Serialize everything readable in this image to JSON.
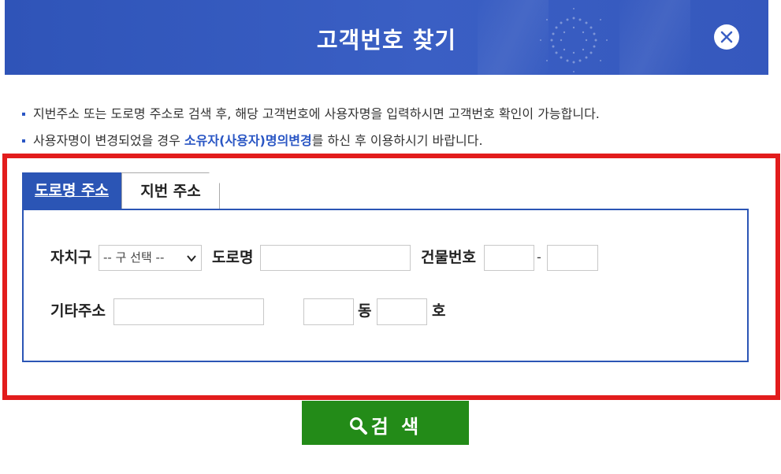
{
  "header": {
    "title": "고객번호 찾기",
    "close_icon": "close-icon"
  },
  "notes": [
    {
      "text": "지번주소 또는 도로명 주소로 검색 후, 해당 고객번호에 사용자명을 입력하시면 고객번호 확인이 가능합니다."
    },
    {
      "before": "사용자명이 변경되었을 경우 ",
      "highlight": "소유자(사용자)명의변경",
      "after": "를 하신 후 이용하시기 바랍니다."
    }
  ],
  "tabs": [
    {
      "label": "도로명 주소",
      "active": true
    },
    {
      "label": "지번 주소",
      "active": false
    }
  ],
  "form": {
    "district_label": "자치구",
    "district_select": "-- 구 선택 --",
    "road_label": "도로명",
    "road_value": "",
    "building_label": "건물번호",
    "building_main": "",
    "building_dash": "-",
    "building_sub": "",
    "etc_label": "기타주소",
    "etc_value": "",
    "dong_value": "",
    "dong_label": "동",
    "ho_value": "",
    "ho_label": "호"
  },
  "search_button": {
    "label": "검 색",
    "icon": "search-icon"
  },
  "colors": {
    "header_bg": "#2f54b8",
    "accent_blue": "#2b55b5",
    "highlight_frame": "#e21c1c",
    "search_green": "#238b18"
  }
}
